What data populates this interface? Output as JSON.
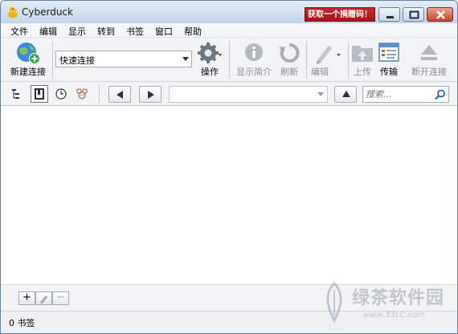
{
  "window": {
    "title": "Cyberduck",
    "donate_label": "获取一个捐赠码！"
  },
  "menu": [
    "文件",
    "编辑",
    "显示",
    "转到",
    "书签",
    "窗口",
    "帮助"
  ],
  "toolbar": {
    "new_connection": "新建连接",
    "quick_connect": "快速连接",
    "action": "操作",
    "get_info": "显示简介",
    "refresh": "刷新",
    "edit": "编辑",
    "upload": "上传",
    "transfers": "传输",
    "disconnect": "断开连接"
  },
  "navbar": {
    "search_placeholder": "搜索..."
  },
  "bottom": {
    "add_label": "+",
    "remove_label": "−"
  },
  "status": {
    "text": "0 书签"
  },
  "watermark": {
    "title": "绿茶软件园",
    "url": "www.33LC.com"
  },
  "colors": {
    "donate_red": "#b81d22",
    "titlebar": "#c4d5e8",
    "toolbar_bg": "#f2f3f5"
  }
}
